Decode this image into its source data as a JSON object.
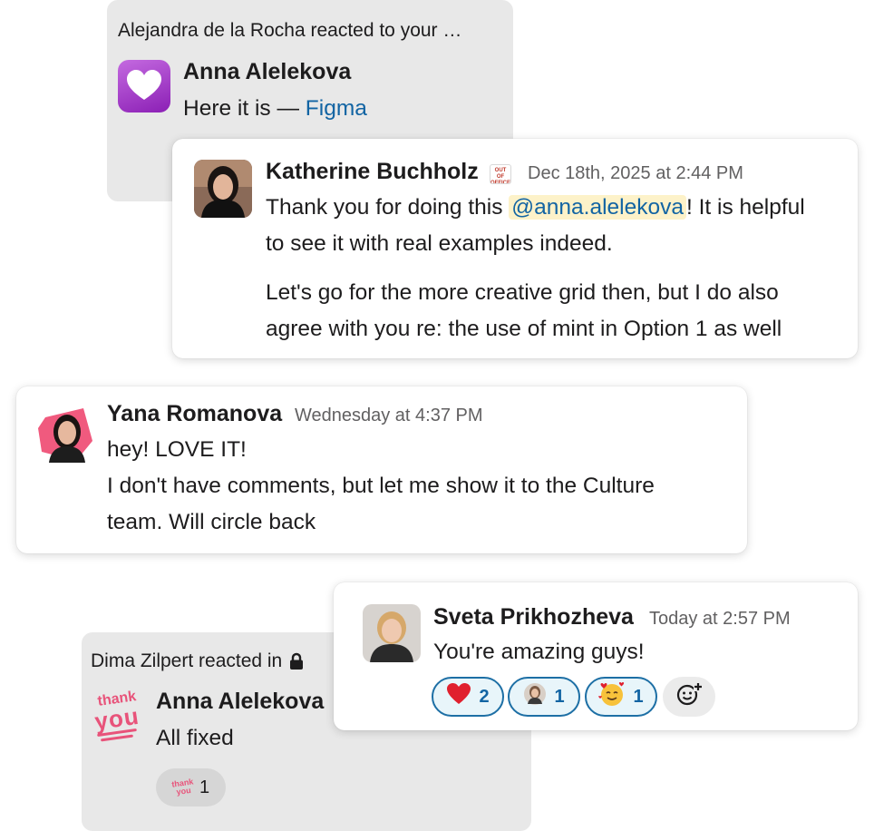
{
  "card1": {
    "notification": "Alejandra de la Rocha reacted to your …",
    "author": "Anna Alelekova",
    "message_prefix": "Here it is — ",
    "message_link": "Figma",
    "avatar_icon": "purple-heart-icon"
  },
  "card2": {
    "author": "Katherine Buchholz",
    "status_badge": "OUT OF OFFICE",
    "timestamp": "Dec 18th, 2025 at 2:44 PM",
    "p1_before": "Thank you for doing this ",
    "p1_mention": "@anna.alelekova",
    "p1_after": "! It is helpful",
    "p1_line2": "to see it with real examples indeed.",
    "p2_line1": "Let's go for the more creative grid then, but I do also",
    "p2_line2": "agree with you re: the use of mint in Option 1 as well"
  },
  "card3": {
    "author": "Yana Romanova",
    "timestamp": "Wednesday at 4:37 PM",
    "line1": "hey! LOVE IT!",
    "line2": "I don't have comments, but let me show it to the Culture",
    "line3": "team. Will circle back"
  },
  "card4": {
    "notification": "Dima Zilpert reacted in",
    "lock_icon": "lock-icon",
    "author": "Anna Alelekova",
    "message": "All fixed",
    "avatar_sticker_top": "thank",
    "avatar_sticker_bottom": "you",
    "reaction_count": "1"
  },
  "card5": {
    "author": "Sveta Prikhozheva",
    "timestamp": "Today at 2:57 PM",
    "message": "You're amazing guys!",
    "reactions": [
      {
        "emoji": "❤️",
        "icon": "red-heart-icon",
        "count": "2"
      },
      {
        "emoji": "",
        "icon": "person-avatar-emoji-icon",
        "count": "1"
      },
      {
        "emoji": "🥰",
        "icon": "smiling-face-with-hearts-icon",
        "count": "1"
      }
    ],
    "add_reaction_icon": "add-reaction-icon"
  },
  "colors": {
    "link": "#1264a3",
    "mention_bg": "#fdf2c9",
    "gray_card": "#e8e8e8",
    "reaction_border": "#1d6fa5",
    "sticker_pink": "#e8537a"
  }
}
